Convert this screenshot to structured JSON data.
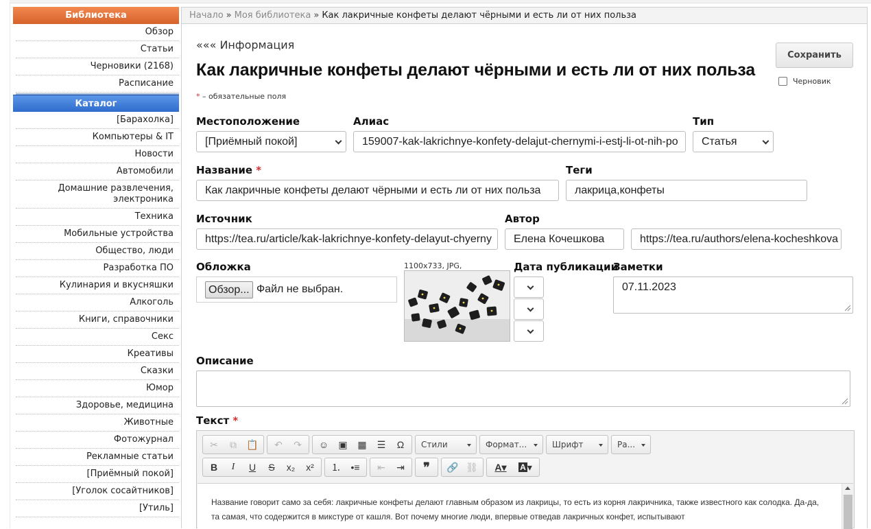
{
  "sidebar": {
    "library_title": "Библиотека",
    "library_items": [
      {
        "label": "Обзор"
      },
      {
        "label": "Статьи"
      },
      {
        "label": "Черновики (2168)"
      },
      {
        "label": "Расписание"
      }
    ],
    "catalog_title": "Каталог",
    "catalog_items": [
      {
        "label": "[Барахолка]"
      },
      {
        "label": "Компьютеры & IT"
      },
      {
        "label": "Новости"
      },
      {
        "label": "Автомобили"
      },
      {
        "label": "Домашние развлечения, электроника"
      },
      {
        "label": "Техника"
      },
      {
        "label": "Мобильные устройства"
      },
      {
        "label": "Общество, люди"
      },
      {
        "label": "Разработка ПО"
      },
      {
        "label": "Кулинария и вкусняшки"
      },
      {
        "label": "Алкоголь"
      },
      {
        "label": "Книги, справочники"
      },
      {
        "label": "Секс"
      },
      {
        "label": "Креативы"
      },
      {
        "label": "Сказки"
      },
      {
        "label": "Юмор"
      },
      {
        "label": "Здоровье, медицина"
      },
      {
        "label": "Животные"
      },
      {
        "label": "Фотожурнал"
      },
      {
        "label": "Рекламные статьи"
      },
      {
        "label": "[Приёмный покой]"
      },
      {
        "label": "[Уголок сосайтников]"
      },
      {
        "label": "[Утиль]"
      }
    ]
  },
  "breadcrumb": {
    "home": "Начало",
    "library": "Моя библиотека",
    "separator": "»",
    "current": "Как лакричные конфеты делают чёрными и есть ли от них польза"
  },
  "header": {
    "info_link": "««« Информация",
    "title": "Как лакричные конфеты делают чёрными и есть ли от них польза",
    "required_star": "*",
    "required_note": "– обязательные поля",
    "save_label": "Сохранить",
    "draft_label": "Черновик"
  },
  "form": {
    "location_label": "Местоположение",
    "location_value": "[Приёмный покой]",
    "alias_label": "Алиас",
    "alias_value": "159007-kak-lakrichnye-konfety-delajut-chernymi-i-estj-li-ot-nih-po",
    "type_label": "Тип",
    "type_value": "Статья",
    "name_label": "Название",
    "name_value": "Как лакричные конфеты делают чёрными и есть ли от них польза",
    "tags_label": "Теги",
    "tags_value": "лакрица,конфеты",
    "source_label": "Источник",
    "source_value": "https://tea.ru/article/kak-lakrichnye-konfety-delayut-chyerny",
    "author_label": "Автор",
    "author_name": "Елена Кочешкова",
    "author_url": "https://tea.ru/authors/elena-kocheshkova",
    "cover_label": "Обложка",
    "file_button": "Обзор...",
    "file_text": "Файл не выбран.",
    "image_meta": "1100x733, JPG,",
    "pubdate_label": "Дата публикации",
    "notes_label": "Заметки",
    "notes_value": "07.11.2023",
    "description_label": "Описание",
    "text_label": "Текст"
  },
  "editor": {
    "styles": "Стили",
    "format": "Формат...",
    "font": "Шрифт",
    "size": "Ра...",
    "content": "Название говорит само за себя: лакричные конфеты делают главным образом из лакрицы, то есть из корня лакричника, также известного как солодка. Да-да, та самая, что содержится в микстуре от кашля. Вот почему многие люди, впервые отведав лакричных конфет, испытывают"
  }
}
